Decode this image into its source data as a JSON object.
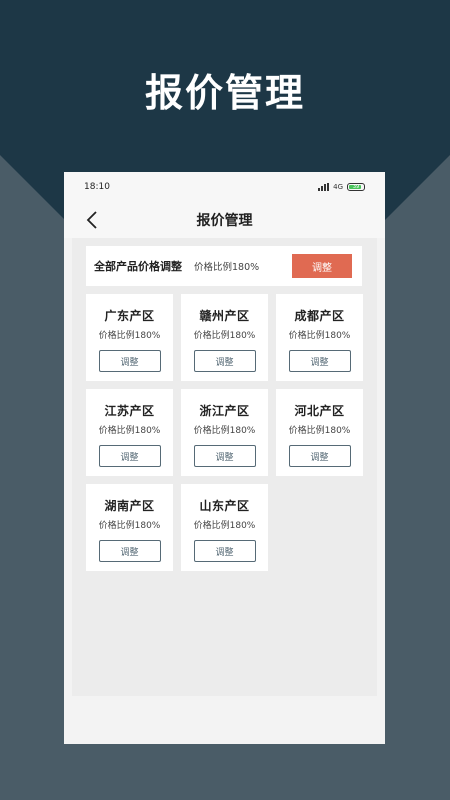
{
  "promo": {
    "title": "报价管理"
  },
  "status_bar": {
    "time": "18:10",
    "network": "4G",
    "battery": "39"
  },
  "nav": {
    "title": "报价管理",
    "back_icon": "chevron-left-icon"
  },
  "all_products": {
    "label": "全部产品价格调整",
    "ratio": "价格比例180%",
    "button_label": "调整",
    "button_color": "#e06a52"
  },
  "regions": [
    {
      "name": "广东产区",
      "ratio": "价格比例180%",
      "button_label": "调整"
    },
    {
      "name": "赣州产区",
      "ratio": "价格比例180%",
      "button_label": "调整"
    },
    {
      "name": "成都产区",
      "ratio": "价格比例180%",
      "button_label": "调整"
    },
    {
      "name": "江苏产区",
      "ratio": "价格比例180%",
      "button_label": "调整"
    },
    {
      "name": "浙江产区",
      "ratio": "价格比例180%",
      "button_label": "调整"
    },
    {
      "name": "河北产区",
      "ratio": "价格比例180%",
      "button_label": "调整"
    },
    {
      "name": "湖南产区",
      "ratio": "价格比例180%",
      "button_label": "调整"
    },
    {
      "name": "山东产区",
      "ratio": "价格比例180%",
      "button_label": "调整"
    }
  ],
  "colors": {
    "background_dark": "#1d3746",
    "background_slate": "#4a5c67",
    "button_outline": "#566a76"
  }
}
